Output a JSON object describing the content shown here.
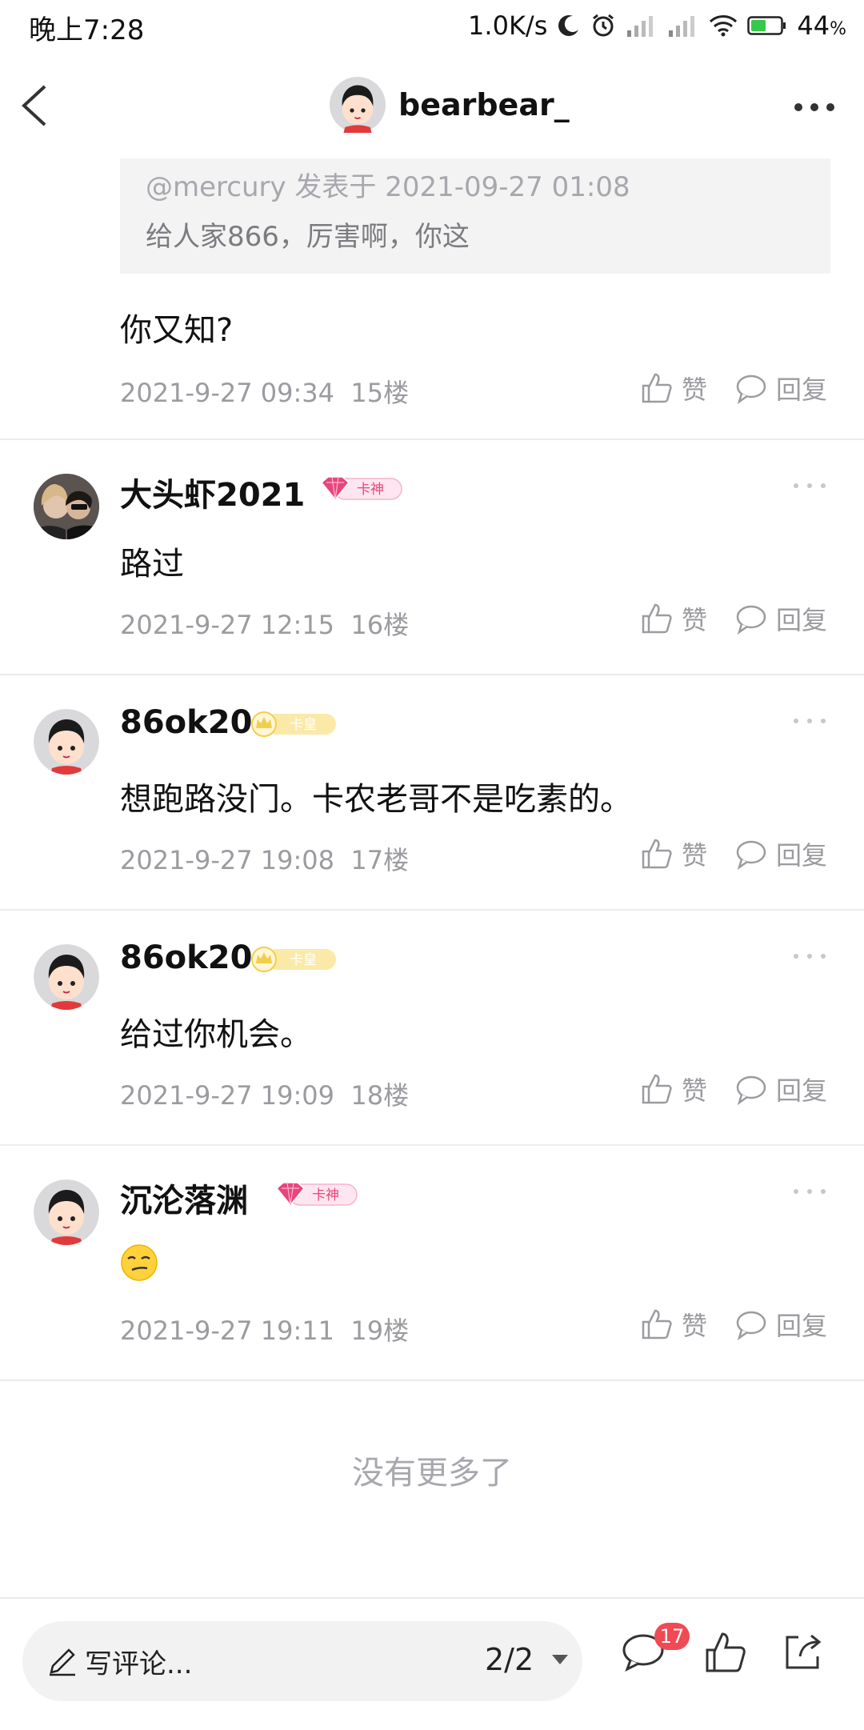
{
  "status_bar": {
    "time": "晚上7:28",
    "net_speed": "1.0K/s",
    "battery": "44",
    "battery_unit": "%"
  },
  "header": {
    "title": "bearbear_",
    "icons": [
      "back-icon",
      "more-icon"
    ]
  },
  "quoted_post": {
    "meta": "@mercury 发表于 2021-09-27 01:08",
    "text": "给人家866，厉害啊，你这"
  },
  "reply": {
    "text": "你又知?",
    "time": "2021-9-27 09:34",
    "floor": "15楼"
  },
  "actions": {
    "like_label": "赞",
    "reply_label": "回复"
  },
  "comments": [
    {
      "name": "大头虾2021",
      "badge": "卡神",
      "badge_type": "gem",
      "text": "路过",
      "time": "2021-9-27 12:15",
      "floor": "16楼"
    },
    {
      "name": "86ok20",
      "badge": "卡皇",
      "badge_type": "crown",
      "text": "想跑路没门。卡农老哥不是吃素的。",
      "time": "2021-9-27 19:08",
      "floor": "17楼"
    },
    {
      "name": "86ok20",
      "badge": "卡皇",
      "badge_type": "crown",
      "text": "给过你机会。",
      "time": "2021-9-27 19:09",
      "floor": "18楼"
    },
    {
      "name": "沉沦落渊",
      "badge": "卡神",
      "badge_type": "gem",
      "text": "",
      "emoji": "smirk-emoji",
      "time": "2021-9-27 19:11",
      "floor": "19楼"
    }
  ],
  "footer_note": "没有更多了",
  "bottom_bar": {
    "placeholder": "写评论...",
    "page": "2/2",
    "comment_count": "17"
  },
  "colors": {
    "accent_red": "#f04a55",
    "gem_pink": "#e8457a",
    "crown_gold": "#f1cf4b",
    "muted_text": "#9b9ba0"
  }
}
